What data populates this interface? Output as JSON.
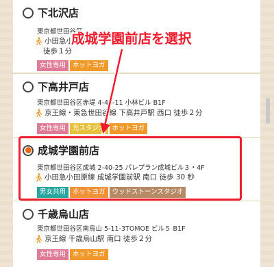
{
  "stores": [
    {
      "name": "下北沢店",
      "address": "東京都世田谷区",
      "access": "小田急小田原線",
      "access_line2": "徒歩１分",
      "selected": false,
      "tags": [
        "女性専用",
        "ホットヨガ"
      ]
    },
    {
      "name": "下高井戸店",
      "address": "東京都世田谷区赤堤 4-46-11 小林ビル B1F",
      "access": "京王線・東急世田谷線 下高井戸駅 西口 徒歩２分",
      "selected": false,
      "tags": [
        "女性専用",
        "光スタジオ",
        "ホットヨガ"
      ]
    },
    {
      "name": "成城学園前店",
      "address": "東京都世田谷区成城 2-40-25 パレプラン成城ビル３・4F",
      "access": "小田急小田原線 成城学園前駅 南口 徒歩 30 秒",
      "selected": true,
      "tags": [
        "男女共用",
        "ホットヨガ",
        "ウッドストーンスタジオ"
      ]
    },
    {
      "name": "千歳烏山店",
      "address": "東京都世田谷区南烏山 5-11-3TOMOE ビル５ B1F",
      "access": "京王線 千歳烏山駅 南口 徒歩２分",
      "selected": false,
      "tags": [
        "女性専用",
        "ホットヨガ"
      ]
    }
  ],
  "annotation": {
    "text": "成城学園前店を選択",
    "color": "#ee1c2d"
  },
  "icons": {
    "access": "walking-person-icon",
    "radio": "radio-button-icon"
  }
}
